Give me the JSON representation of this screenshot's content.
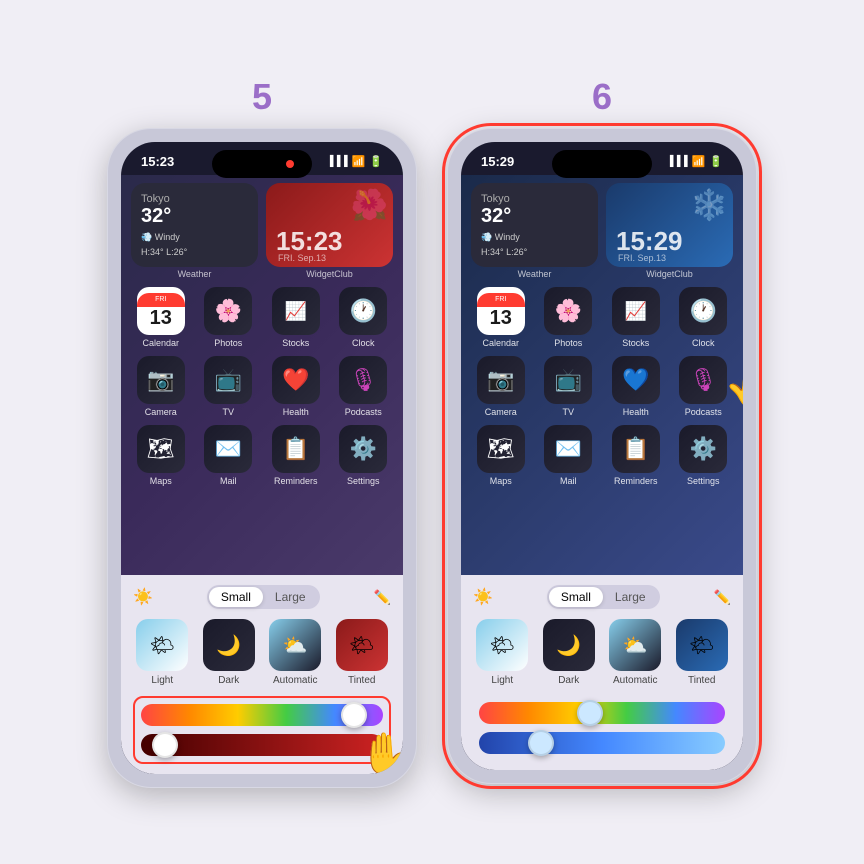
{
  "sections": [
    {
      "number": "5",
      "phone": {
        "time": "15:23",
        "hasDot": true,
        "screenTint": "red",
        "weatherWidget": {
          "city": "Tokyo",
          "temp": "32°",
          "condition": "Windy",
          "details": "H:34° L:26°"
        },
        "clockWidget": {
          "time": "15:23",
          "date": "FRI. Sep.13",
          "style": "red"
        },
        "widgetLabels": [
          "Weather",
          "WidgetClub"
        ],
        "appRows": [
          [
            {
              "label": "Calendar",
              "day": "13",
              "dayName": "FRI"
            },
            {
              "label": "Photos"
            },
            {
              "label": "Stocks"
            },
            {
              "label": "Clock"
            }
          ],
          [
            {
              "label": "Camera"
            },
            {
              "label": "TV"
            },
            {
              "label": "Health"
            },
            {
              "label": "Podcasts"
            }
          ],
          [
            {
              "label": "Maps"
            },
            {
              "label": "Mail"
            },
            {
              "label": "Reminders"
            },
            {
              "label": "Settings"
            }
          ]
        ],
        "sizeToggle": {
          "small": "Small",
          "large": "Large",
          "active": "Small"
        },
        "styleOptions": [
          "Light",
          "Dark",
          "Automatic",
          "Tinted"
        ],
        "sliders": {
          "highlighted": true,
          "rainbow": {
            "thumbPosition": 88
          },
          "blue": {
            "thumbPosition": 10
          }
        },
        "handPosition": "sliders"
      }
    },
    {
      "number": "6",
      "phone": {
        "time": "15:29",
        "hasDot": false,
        "screenTint": "blue",
        "highlighted": true,
        "weatherWidget": {
          "city": "Tokyo",
          "temp": "32°",
          "condition": "Windy",
          "details": "H:34° L:26°"
        },
        "clockWidget": {
          "time": "15:29",
          "date": "FRI. Sep.13",
          "style": "blue"
        },
        "widgetLabels": [
          "Weather",
          "WidgetClub"
        ],
        "appRows": [
          [
            {
              "label": "Calendar",
              "day": "13",
              "dayName": "FRI"
            },
            {
              "label": "Photos"
            },
            {
              "label": "Stocks"
            },
            {
              "label": "Clock"
            }
          ],
          [
            {
              "label": "Camera"
            },
            {
              "label": "TV"
            },
            {
              "label": "Health"
            },
            {
              "label": "Podcasts"
            }
          ],
          [
            {
              "label": "Maps"
            },
            {
              "label": "Mail"
            },
            {
              "label": "Reminders"
            },
            {
              "label": "Settings"
            }
          ]
        ],
        "sizeToggle": {
          "small": "Small",
          "large": "Large",
          "active": "Small"
        },
        "styleOptions": [
          "Light",
          "Dark",
          "Automatic",
          "Tinted"
        ],
        "sliders": {
          "highlighted": false,
          "rainbow": {
            "thumbPosition": 45
          },
          "blue": {
            "thumbPosition": 25
          }
        },
        "handPosition": "podcasts"
      }
    }
  ]
}
